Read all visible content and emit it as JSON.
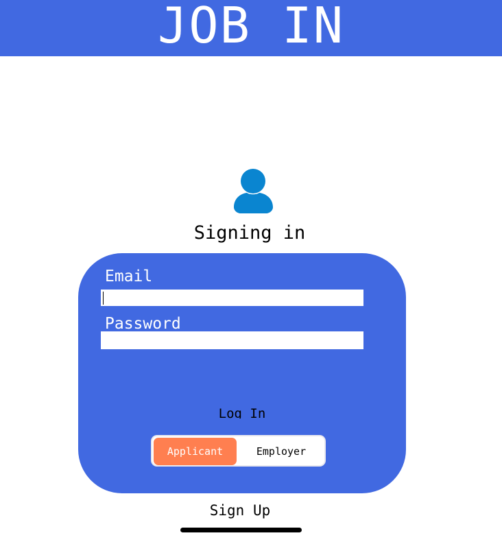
{
  "header": {
    "title": "JOB IN",
    "background_color": "#4169e1"
  },
  "login": {
    "icon": "user-icon",
    "title": "Signing in",
    "email_label": "Email",
    "email_value": "",
    "password_label": "Password",
    "password_value": "",
    "login_label": "Log In",
    "card_color": "#4169e1"
  },
  "role_toggle": {
    "options": [
      "Applicant",
      "Employer"
    ],
    "selected": "Applicant",
    "selected_color": "#ff7f50"
  },
  "signup_label": "Sign Up"
}
